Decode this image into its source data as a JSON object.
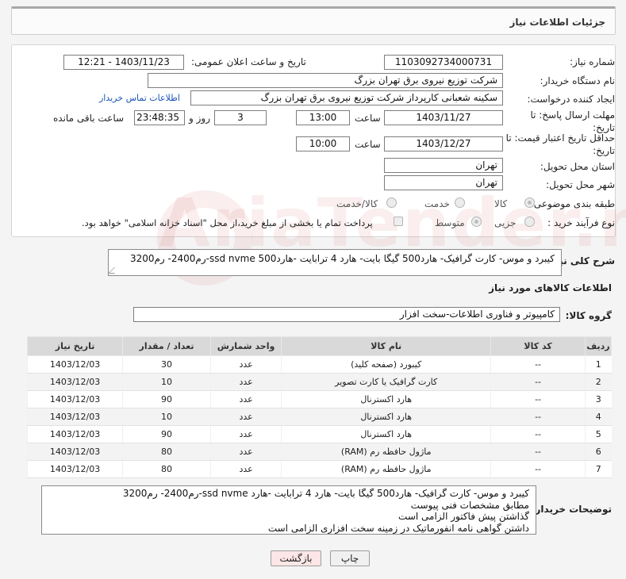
{
  "header": {
    "title": "جزئیات اطلاعات نیاز"
  },
  "form": {
    "need_number_label": "شماره نیاز:",
    "need_number": "1103092734000731",
    "announce_label": "تاریخ و ساعت اعلان عمومی:",
    "announce_value": "1403/11/23 - 12:21",
    "buyer_org_label": "نام دستگاه خریدار:",
    "buyer_org": "شرکت توزیع نیروی برق تهران بزرگ",
    "creator_label": "ایجاد کننده درخواست:",
    "creator": "سکینه شعبانی کارپرداز شرکت توزیع نیروی برق تهران بزرگ",
    "contact_link": "اطلاعات تماس خریدار",
    "deadline_label_1": "مهلت ارسال پاسخ: تا",
    "deadline_label_2": "تاریخ:",
    "deadline_date": "1403/11/27",
    "time_label": "ساعت",
    "deadline_time": "13:00",
    "days_value": "3",
    "days_label": "روز و",
    "remaining_time": "23:48:35",
    "remaining_label": "ساعت باقی مانده",
    "validity_label_1": "حداقل تاریخ اعتبار قیمت: تا",
    "validity_label_2": "تاریخ:",
    "validity_date": "1403/12/27",
    "validity_time_label": "ساعت",
    "validity_time": "10:00",
    "province_label": "استان محل تحویل:",
    "province": "تهران",
    "city_label": "شهر محل تحویل:",
    "city": "تهران",
    "category_label": "طبقه بندی موضوعی:",
    "category_options": [
      "کالا",
      "خدمت",
      "کالا/خدمت"
    ],
    "category_selected": "کالا",
    "process_label": "نوع فرآیند خرید :",
    "process_options": [
      "جزیی",
      "متوسط"
    ],
    "payment_note": "پرداخت تمام یا بخشی از مبلغ خرید،از محل \"اسناد خزانه اسلامی\" خواهد بود."
  },
  "description": {
    "label": "شرح کلی نیاز:",
    "value": "کیبرد و موس- کارت گرافیک- هارد500 گیگا بایت- هارد 4 ترابایت -هاردssd nvme 500-رم2400- رم3200"
  },
  "goods": {
    "section_title": "اطلاعات کالاهای مورد نیاز",
    "group_label": "گروه کالا:",
    "group_value": "کامپیوتر و فناوری اطلاعات-سخت افزار",
    "columns": [
      "ردیف",
      "کد کالا",
      "نام کالا",
      "واحد شمارش",
      "تعداد / مقدار",
      "تاریخ نیاز"
    ],
    "rows": [
      {
        "idx": "1",
        "code": "--",
        "name": "کیبورد (صفحه کلید)",
        "unit": "عدد",
        "qty": "30",
        "date": "1403/12/03"
      },
      {
        "idx": "2",
        "code": "--",
        "name": "کارت گرافیک یا کارت تصویر",
        "unit": "عدد",
        "qty": "10",
        "date": "1403/12/03"
      },
      {
        "idx": "3",
        "code": "--",
        "name": "هارد اکسترنال",
        "unit": "عدد",
        "qty": "90",
        "date": "1403/12/03"
      },
      {
        "idx": "4",
        "code": "--",
        "name": "هارد اکسترنال",
        "unit": "عدد",
        "qty": "10",
        "date": "1403/12/03"
      },
      {
        "idx": "5",
        "code": "--",
        "name": "هارد اکسترنال",
        "unit": "عدد",
        "qty": "90",
        "date": "1403/12/03"
      },
      {
        "idx": "6",
        "code": "--",
        "name": "ماژول حافظه رم (RAM)",
        "unit": "عدد",
        "qty": "80",
        "date": "1403/12/03"
      },
      {
        "idx": "7",
        "code": "--",
        "name": "ماژول حافظه رم (RAM)",
        "unit": "عدد",
        "qty": "80",
        "date": "1403/12/03"
      }
    ]
  },
  "buyer_notes": {
    "label": "توضیحات خریدار:",
    "lines": [
      "کیبرد و موس- کارت گرافیک- هارد500 گیگا بایت- هارد 4 ترابایت -هارد ssd nvme-رم2400- رم3200",
      "مطابق مشخصات فنی پیوست",
      "گذاشتن پیش فاکتور الزامی است",
      "داشتن گواهی نامه انفورماتیک در زمینه سخت افزاری الزامی است"
    ]
  },
  "buttons": {
    "print": "چاپ",
    "back": "بازگشت"
  },
  "watermark": "AriaTender.neT"
}
